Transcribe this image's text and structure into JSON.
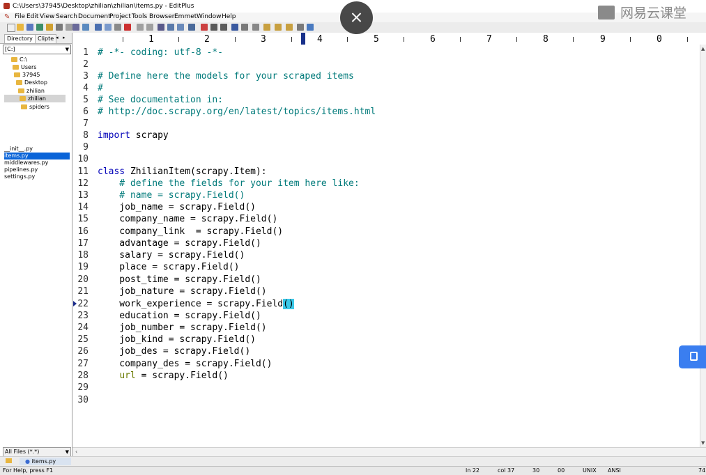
{
  "window": {
    "title": "C:\\Users\\37945\\Desktop\\zhilian\\zhilian\\items.py - EditPlus"
  },
  "menu": [
    "File",
    "Edit",
    "View",
    "Search",
    "Document",
    "Project",
    "Tools",
    "Browser",
    "Emmet",
    "Window",
    "Help"
  ],
  "ruler": {
    "numbers": [
      "1",
      "2",
      "3",
      "4",
      "5",
      "6",
      "7",
      "8",
      "9",
      "0"
    ]
  },
  "sidebar": {
    "tabs": [
      "Directory",
      "Clipte"
    ],
    "drive": "[C:]",
    "tree": [
      "C:\\",
      "Users",
      "37945",
      "Desktop",
      "zhilian",
      "zhilian",
      "spiders"
    ],
    "files": [
      "__init__.py",
      "items.py",
      "middlewares.py",
      "pipelines.py",
      "settings.py"
    ],
    "filter": "All Files (*.*)"
  },
  "editor": {
    "lines": [
      {
        "num": "1",
        "text": "# -*- coding: utf-8 -*-"
      },
      {
        "num": "2",
        "text": ""
      },
      {
        "num": "3",
        "text": "# Define here the models for your scraped items"
      },
      {
        "num": "4",
        "text": "#"
      },
      {
        "num": "5",
        "text": "# See documentation in:"
      },
      {
        "num": "6",
        "text": "# http://doc.scrapy.org/en/latest/topics/items.html"
      },
      {
        "num": "7",
        "text": ""
      },
      {
        "num": "8",
        "text": "import scrapy"
      },
      {
        "num": "9",
        "text": ""
      },
      {
        "num": "10",
        "text": ""
      },
      {
        "num": "11",
        "text": "class ZhilianItem(scrapy.Item):"
      },
      {
        "num": "12",
        "text": "    # define the fields for your item here like:"
      },
      {
        "num": "13",
        "text": "    # name = scrapy.Field()"
      },
      {
        "num": "14",
        "text": "    job_name = scrapy.Field()"
      },
      {
        "num": "15",
        "text": "    company_name = scrapy.Field()"
      },
      {
        "num": "16",
        "text": "    company_link  = scrapy.Field()"
      },
      {
        "num": "17",
        "text": "    advantage = scrapy.Field()"
      },
      {
        "num": "18",
        "text": "    salary = scrapy.Field()"
      },
      {
        "num": "19",
        "text": "    place = scrapy.Field()"
      },
      {
        "num": "20",
        "text": "    post_time = scrapy.Field()"
      },
      {
        "num": "21",
        "text": "    job_nature = scrapy.Field()"
      },
      {
        "num": "22",
        "text": "    work_experience = scrapy.Field()"
      },
      {
        "num": "23",
        "text": "    education = scrapy.Field()"
      },
      {
        "num": "24",
        "text": "    job_number = scrapy.Field()"
      },
      {
        "num": "25",
        "text": "    job_kind = scrapy.Field()"
      },
      {
        "num": "26",
        "text": "    job_des = scrapy.Field()"
      },
      {
        "num": "27",
        "text": "    company_des = scrapy.Field()"
      },
      {
        "num": "28",
        "text": "    url = scrapy.Field()"
      },
      {
        "num": "29",
        "text": ""
      },
      {
        "num": "30",
        "text": ""
      }
    ]
  },
  "tabs": {
    "open_file": "items.py"
  },
  "status": {
    "help": "For Help, press F1",
    "ln": "ln 22",
    "col": "col 37",
    "n1": "30",
    "n2": "00",
    "eol": "UNIX",
    "enc": "ANSI",
    "n3": "74"
  },
  "overlay": {
    "watermark": "网易云课堂"
  }
}
